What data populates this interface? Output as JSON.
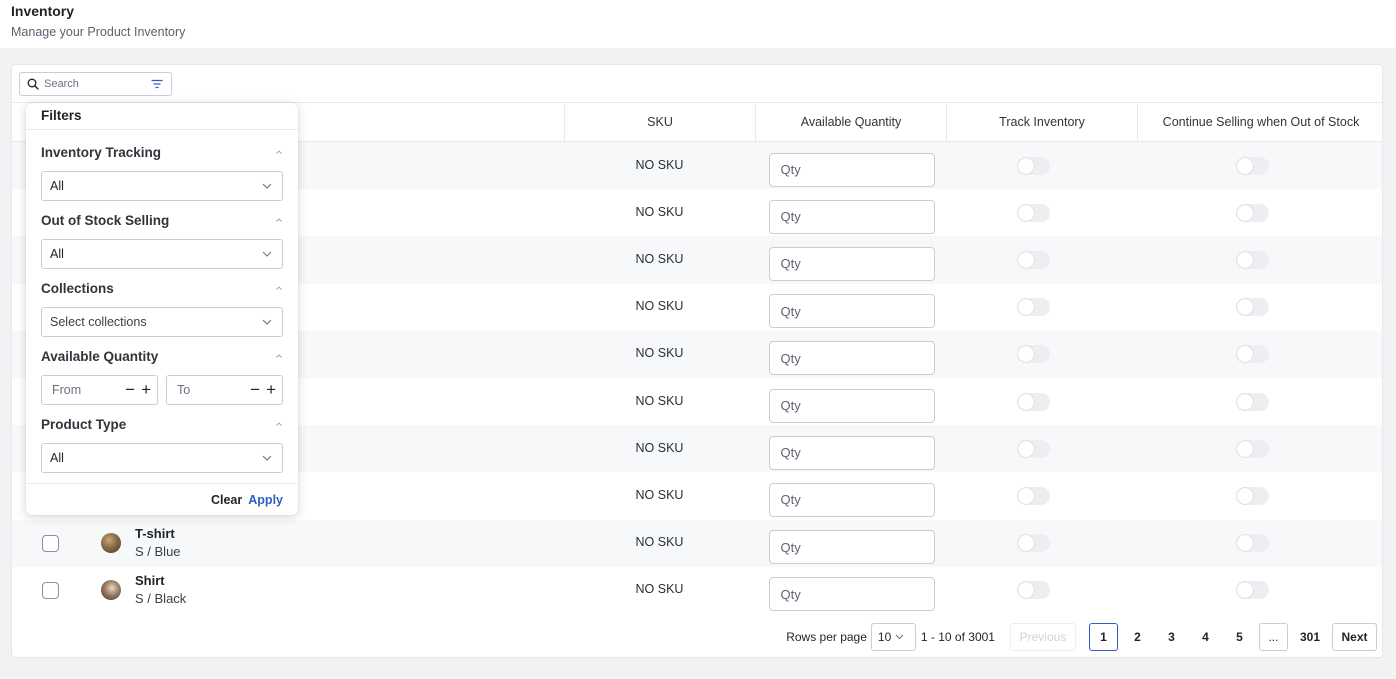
{
  "header": {
    "title": "Inventory",
    "subtitle": "Manage your Product Inventory"
  },
  "toolbar": {
    "search_placeholder": "Search"
  },
  "columns": {
    "sku": "SKU",
    "available_quantity": "Available Quantity",
    "track_inventory": "Track Inventory",
    "continue_selling": "Continue Selling when Out of Stock"
  },
  "rows": [
    {
      "name": "",
      "variant": "",
      "sku": "NO SKU",
      "qty_placeholder": "Qty",
      "track": false,
      "continue": false
    },
    {
      "name": "",
      "variant": "",
      "sku": "NO SKU",
      "qty_placeholder": "Qty",
      "track": false,
      "continue": false
    },
    {
      "name": "",
      "variant": "",
      "sku": "NO SKU",
      "qty_placeholder": "Qty",
      "track": false,
      "continue": false
    },
    {
      "name": "",
      "variant": "",
      "sku": "NO SKU",
      "qty_placeholder": "Qty",
      "track": false,
      "continue": false
    },
    {
      "name": "",
      "variant": "",
      "sku": "NO SKU",
      "qty_placeholder": "Qty",
      "track": false,
      "continue": false
    },
    {
      "name": "",
      "variant": "",
      "sku": "NO SKU",
      "qty_placeholder": "Qty",
      "track": false,
      "continue": false
    },
    {
      "name": "",
      "variant": "",
      "sku": "NO SKU",
      "qty_placeholder": "Qty",
      "track": false,
      "continue": false
    },
    {
      "name": "",
      "variant": "",
      "sku": "NO SKU",
      "qty_placeholder": "Qty",
      "track": false,
      "continue": false
    },
    {
      "name": "T-shirt",
      "variant": "S / Blue",
      "sku": "NO SKU",
      "qty_placeholder": "Qty",
      "track": false,
      "continue": false
    },
    {
      "name": "Shirt",
      "variant": "S / Black",
      "sku": "NO SKU",
      "qty_placeholder": "Qty",
      "track": false,
      "continue": false
    }
  ],
  "pagination": {
    "rows_per_page_label": "Rows per page",
    "rows_per_page_value": "10",
    "range": "1 - 10 of 3001",
    "previous": "Previous",
    "pages": [
      "1",
      "2",
      "3",
      "4",
      "5"
    ],
    "ellipsis": "...",
    "last_page": "301",
    "next": "Next",
    "current_page": "1"
  },
  "filters": {
    "title": "Filters",
    "inventory_tracking": {
      "label": "Inventory Tracking",
      "value": "All"
    },
    "out_of_stock_selling": {
      "label": "Out of Stock Selling",
      "value": "All"
    },
    "collections": {
      "label": "Collections",
      "placeholder": "Select collections"
    },
    "available_quantity": {
      "label": "Available Quantity",
      "from_placeholder": "From",
      "to_placeholder": "To",
      "minus": "−",
      "plus": "+"
    },
    "product_type": {
      "label": "Product Type",
      "value": "All"
    },
    "clear": "Clear",
    "apply": "Apply"
  },
  "colors": {
    "accent": "#2f5fc4",
    "toggle_off": "#eceef1",
    "row_alt": "#f7f8fa"
  },
  "icons": {
    "search": "search-icon",
    "filter": "filter-icon",
    "chevron_down": "chevron-down-icon",
    "caret_up": "caret-up-icon"
  }
}
